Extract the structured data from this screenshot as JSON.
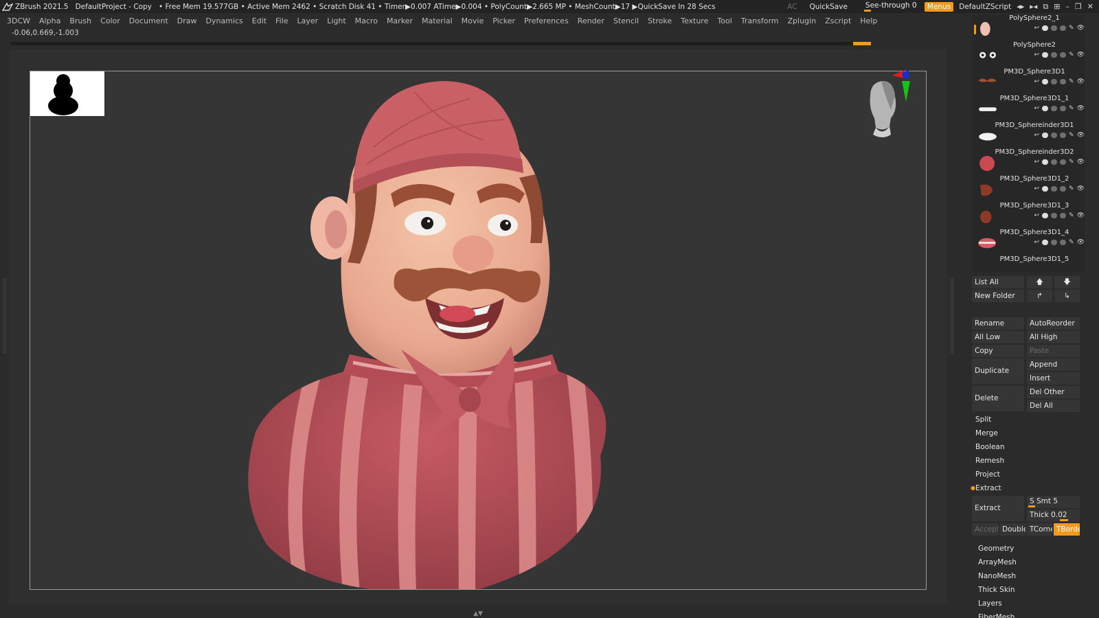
{
  "app": {
    "title": "ZBrush 2021.5",
    "project": "DefaultProject - Copy",
    "stats": "• Free Mem 19.577GB • Active Mem 2462 • Scratch Disk 41 • Timer▶0.007 ATime▶0.004 • PolyCount▶2.665 MP • MeshCount▶17 ▶QuickSave In 28 Secs",
    "ac_label": "AC",
    "quicksave_label": "QuickSave",
    "see_through_label": "See-through  0",
    "see_through_value": 0,
    "menus_label": "Menus",
    "zscript_label": "DefaultZScript",
    "colors": {
      "accent": "#f29a1d",
      "bg": "#2b2b2b",
      "canvas": "#353535"
    }
  },
  "menubar": [
    "3DCW",
    "Alpha",
    "Brush",
    "Color",
    "Document",
    "Draw",
    "Dynamics",
    "Edit",
    "File",
    "Layer",
    "Light",
    "Macro",
    "Marker",
    "Material",
    "Movie",
    "Picker",
    "Preferences",
    "Render",
    "Stencil",
    "Stroke",
    "Texture",
    "Tool",
    "Transform",
    "Zplugin",
    "Zscript",
    "Help"
  ],
  "coords": "-0.06,0.669,-1.003",
  "subtools": [
    {
      "name": "PolySphere2_1",
      "thumb": "arm",
      "selected": true
    },
    {
      "name": "PolySphere2",
      "thumb": "eyes",
      "selected": false
    },
    {
      "name": "PM3D_Sphere3D1",
      "thumb": "mustache",
      "selected": false
    },
    {
      "name": "PM3D_Sphere3D1_1",
      "thumb": "teeth",
      "selected": false
    },
    {
      "name": "PM3D_Sphereinder3D1",
      "thumb": "disc",
      "selected": false
    },
    {
      "name": "PM3D_Sphereinder3D2",
      "thumb": "head-red",
      "selected": false
    },
    {
      "name": "PM3D_Sphere3D1_2",
      "thumb": "ear-brown",
      "selected": false
    },
    {
      "name": "PM3D_Sphere3D1_3",
      "thumb": "blob-brown",
      "selected": false
    },
    {
      "name": "PM3D_Sphere3D1_4",
      "thumb": "lips",
      "selected": false
    },
    {
      "name": "PM3D_Sphere3D1_5",
      "thumb": "none",
      "selected": false
    }
  ],
  "panel": {
    "list_all": "List All",
    "new_folder": "New Folder",
    "rename": "Rename",
    "autoreorder": "AutoReorder",
    "all_low": "All Low",
    "all_high": "All High",
    "copy": "Copy",
    "paste": "Paste",
    "duplicate": "Duplicate",
    "append": "Append",
    "insert": "Insert",
    "delete": "Delete",
    "del_other": "Del Other",
    "del_all": "Del All",
    "split": "Split",
    "merge": "Merge",
    "boolean": "Boolean",
    "remesh": "Remesh",
    "project": "Project",
    "extract_header": "Extract",
    "extract_btn": "Extract",
    "s_smt_label": "S Smt 5",
    "s_smt_value": 5,
    "thick_label": "Thick 0.02",
    "thick_value": 0.02,
    "accept": "Accept",
    "double": "Double",
    "tcorne": "TCorne",
    "tborde": "TBorde",
    "sections": [
      "Geometry",
      "ArrayMesh",
      "NanoMesh",
      "Thick Skin",
      "Layers",
      "FiberMesh"
    ]
  }
}
